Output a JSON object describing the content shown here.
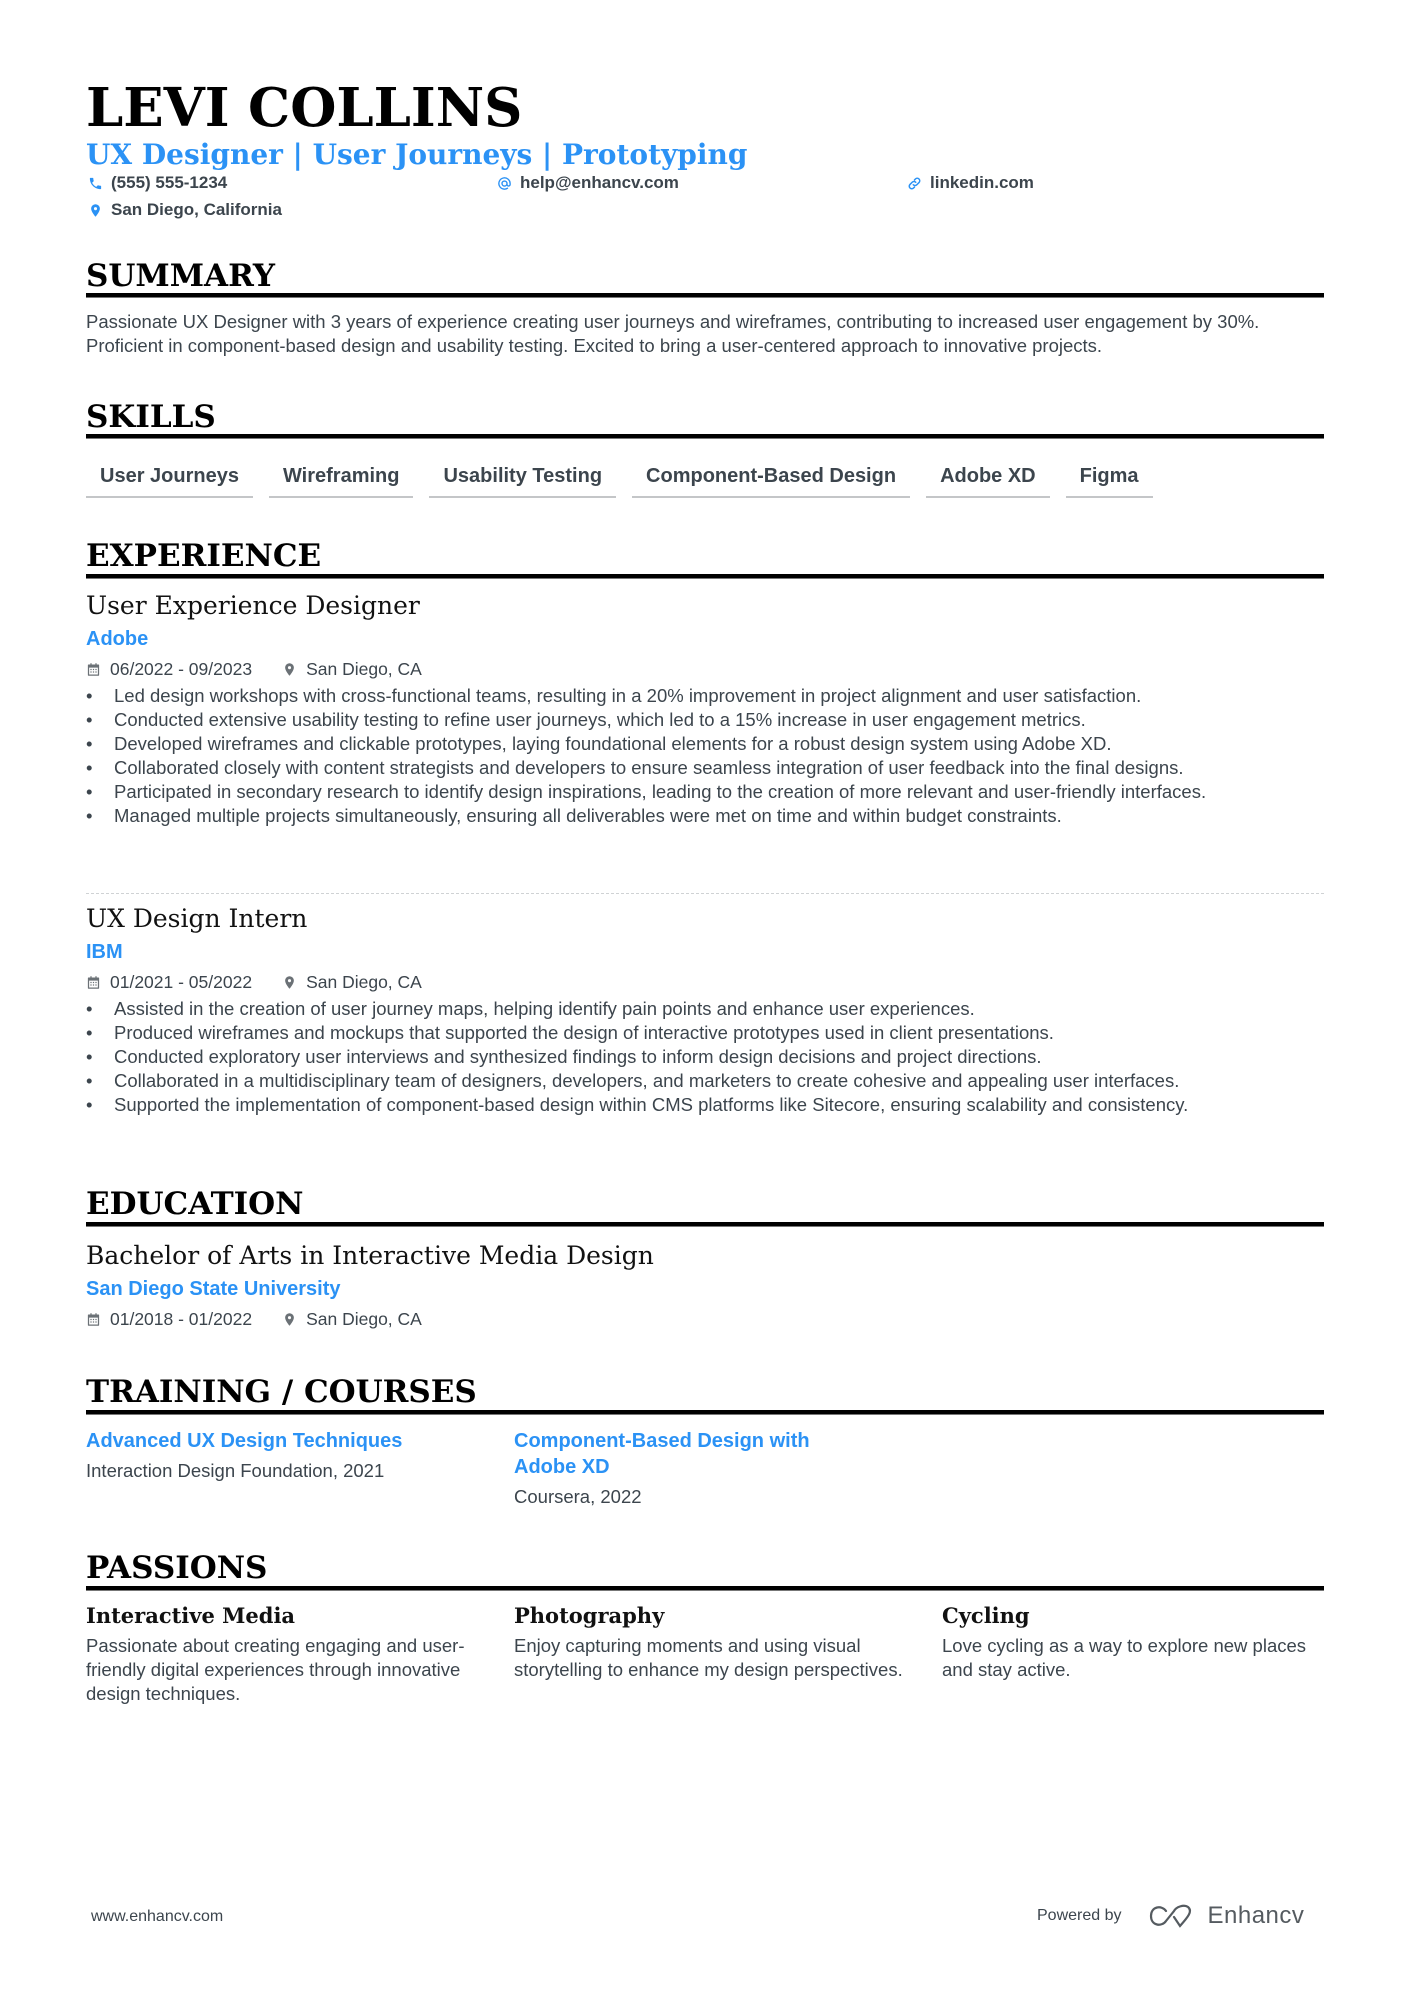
{
  "header": {
    "name": "LEVI COLLINS",
    "headline": "UX Designer | User Journeys | Prototyping",
    "contacts": [
      {
        "icon": "phone-icon",
        "text": "(555) 555-1234"
      },
      {
        "icon": "at-icon",
        "text": "help@enhancv.com"
      },
      {
        "icon": "link-icon",
        "text": "linkedin.com"
      },
      {
        "icon": "location-pin-icon",
        "text": "San Diego, California"
      }
    ]
  },
  "colors": {
    "accent": "#2b92f5",
    "text": "#3c454d",
    "heading": "#000000"
  },
  "summary": {
    "title": "SUMMARY",
    "text": "Passionate UX Designer with 3 years of experience creating user journeys and wireframes, contributing to increased user engagement by 30%. Proficient in component-based design and usability testing. Excited to bring a user-centered approach to innovative projects."
  },
  "skills": {
    "title": "SKILLS",
    "items": [
      "User Journeys",
      "Wireframing",
      "Usability Testing",
      "Component-Based Design",
      "Adobe XD",
      "Figma"
    ]
  },
  "experience": {
    "title": "EXPERIENCE",
    "jobs": [
      {
        "title": "User Experience Designer",
        "company": "Adobe",
        "dates": "06/2022 - 09/2023",
        "location": "San Diego, CA",
        "bullets": [
          "Led design workshops with cross-functional teams, resulting in a 20% improvement in project alignment and user satisfaction.",
          "Conducted extensive usability testing to refine user journeys, which led to a 15% increase in user engagement metrics.",
          "Developed wireframes and clickable prototypes, laying foundational elements for a robust design system using Adobe XD.",
          "Collaborated closely with content strategists and developers to ensure seamless integration of user feedback into the final designs.",
          "Participated in secondary research to identify design inspirations, leading to the creation of more relevant and user-friendly interfaces.",
          "Managed multiple projects simultaneously, ensuring all deliverables were met on time and within budget constraints."
        ]
      },
      {
        "title": "UX Design Intern",
        "company": "IBM",
        "dates": "01/2021 - 05/2022",
        "location": "San Diego, CA",
        "bullets": [
          "Assisted in the creation of user journey maps, helping identify pain points and enhance user experiences.",
          "Produced wireframes and mockups that supported the design of interactive prototypes used in client presentations.",
          "Conducted exploratory user interviews and synthesized findings to inform design decisions and project directions.",
          "Collaborated in a multidisciplinary team of designers, developers, and marketers to create cohesive and appealing user interfaces.",
          "Supported the implementation of component-based design within CMS platforms like Sitecore, ensuring scalability and consistency."
        ]
      }
    ]
  },
  "education": {
    "title": "EDUCATION",
    "degree": "Bachelor of Arts in Interactive Media Design",
    "school": "San Diego State University",
    "dates": "01/2018 - 01/2022",
    "location": "San Diego, CA"
  },
  "training": {
    "title": "TRAINING / COURSES",
    "items": [
      {
        "title": "Advanced UX Design Techniques",
        "detail": "Interaction Design Foundation, 2021"
      },
      {
        "title": "Component-Based Design with Adobe XD",
        "detail": "Coursera, 2022"
      }
    ]
  },
  "passions": {
    "title": "PASSIONS",
    "items": [
      {
        "title": "Interactive Media",
        "desc": "Passionate about creating engaging and user-friendly digital experiences through innovative design techniques."
      },
      {
        "title": "Photography",
        "desc": "Enjoy capturing moments and using visual storytelling to enhance my design perspectives."
      },
      {
        "title": "Cycling",
        "desc": "Love cycling as a way to explore new places and stay active."
      }
    ]
  },
  "footer": {
    "website": "www.enhancv.com",
    "powered_by": "Powered by",
    "brand": "Enhancv"
  }
}
